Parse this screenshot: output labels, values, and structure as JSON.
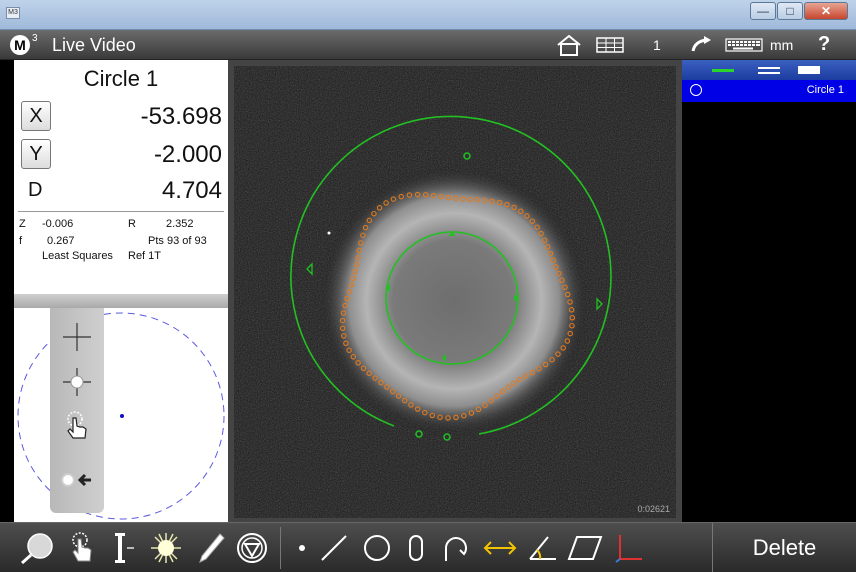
{
  "window": {
    "app_icon_text": "M3",
    "controls": [
      "minimize",
      "maximize",
      "close"
    ]
  },
  "header": {
    "logo_letter": "M",
    "logo_sup": "3",
    "title": "Live Video",
    "count": "1",
    "units": "mm",
    "help": "?",
    "icons": [
      "home-icon",
      "grid-icon",
      "undo-icon",
      "keyboard-icon"
    ]
  },
  "dro": {
    "title": "Circle 1",
    "x_label": "X",
    "x_value": "-53.698",
    "y_label": "Y",
    "y_value": "-2.000",
    "d_label": "D",
    "d_value": "4.704",
    "z_label": "Z",
    "z_value": "-0.006",
    "r_label": "R",
    "r_value": "2.352",
    "f_label": "f",
    "f_value": "0.267",
    "pts": "Pts 93 of 93",
    "fit_method": "Least Squares",
    "ref": "Ref 1T"
  },
  "probe_tools": [
    "crosshair-icon",
    "edge-probe-icon",
    "touch-probe-icon",
    "auto-edge-icon"
  ],
  "video": {
    "stamp": "0:02621",
    "colors": {
      "fit": "#22c022",
      "points": "#e07a20"
    }
  },
  "feature_list": {
    "header_icons": [
      "line-weight-thin-icon",
      "line-weight-double-icon",
      "line-weight-bar-icon"
    ],
    "items": [
      {
        "label": "Circle 1",
        "icon": "circle-icon",
        "selected": true
      }
    ]
  },
  "toolbar": {
    "left_icons": [
      "zoom-icon",
      "touch-probe-icon",
      "edge-probe-icon",
      "light-icon",
      "pen-icon",
      "menu-icon"
    ],
    "feature_icons": [
      "point-icon",
      "line-icon",
      "circle-icon",
      "slot-icon",
      "arc-icon",
      "distance-icon",
      "angle-icon",
      "plane-icon",
      "datum-icon"
    ],
    "delete_label": "Delete"
  }
}
